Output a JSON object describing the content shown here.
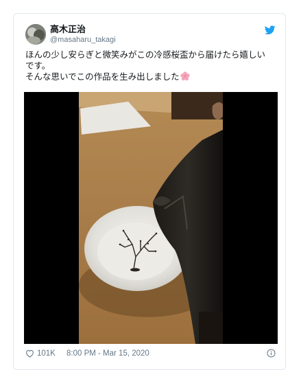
{
  "tweet": {
    "display_name": "高木正治",
    "handle": "@masaharu_takagi",
    "text_lines": [
      "ほんの少し安らぎと微笑みがこの冷感桜盃から届けたら嬉しい",
      "です。",
      "そんな思いでこの作品を生み出しました"
    ],
    "emoji": "cherry-blossom-emoji",
    "likes": "101K",
    "timestamp": "8:00 PM - Mar 15, 2020"
  },
  "icons": {
    "brand": "twitter-bird-icon",
    "like": "heart-icon",
    "info": "info-icon"
  },
  "colors": {
    "twitter_blue": "#1da1f2",
    "secondary_text": "#657786",
    "border": "#e1e8ed"
  }
}
